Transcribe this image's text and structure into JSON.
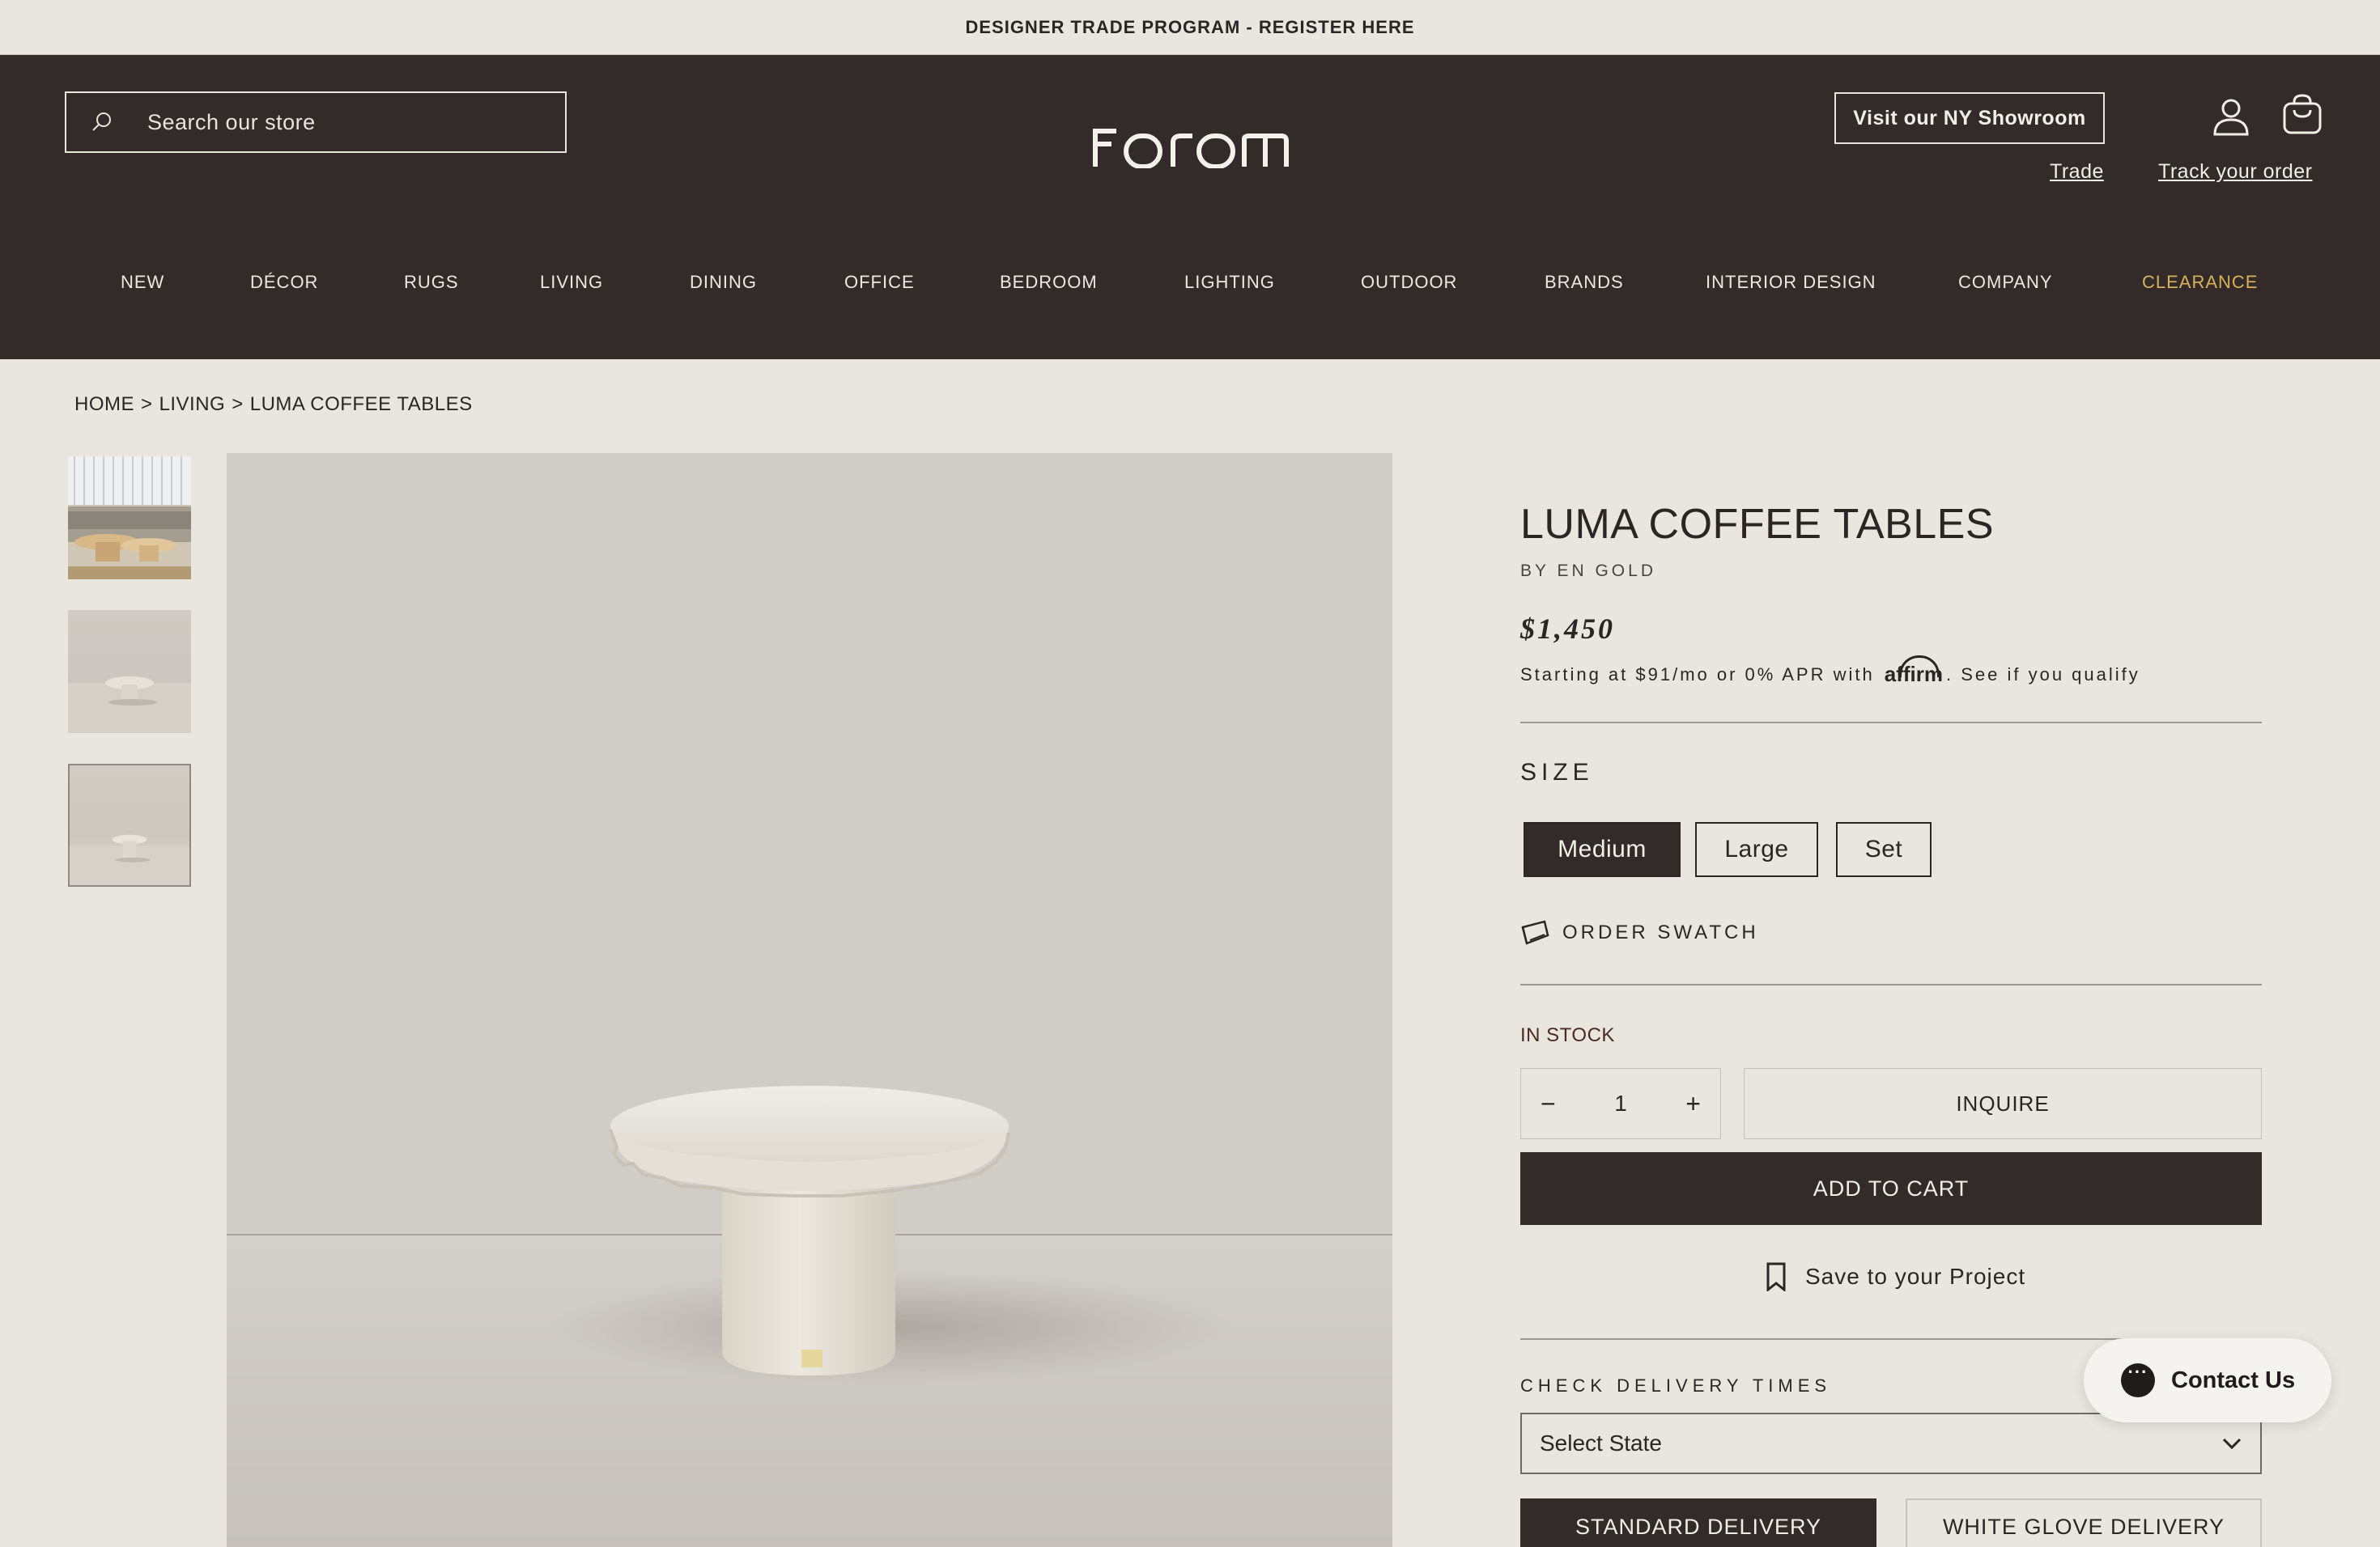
{
  "announcement": "DESIGNER TRADE PROGRAM - REGISTER HERE",
  "header": {
    "search_placeholder": "Search our store",
    "logo": "forom",
    "showroom_button": "Visit our NY Showroom",
    "links": {
      "trade": "Trade",
      "track": "Track your order"
    },
    "icons": {
      "search": "search-icon",
      "account": "account-icon",
      "cart": "cart-icon"
    }
  },
  "nav": {
    "items": [
      "NEW",
      "DÉCOR",
      "RUGS",
      "LIVING",
      "DINING",
      "OFFICE",
      "BEDROOM",
      "LIGHTING",
      "OUTDOOR",
      "BRANDS",
      "INTERIOR DESIGN",
      "COMPANY",
      "CLEARANCE"
    ]
  },
  "breadcrumb": {
    "items": [
      "HOME",
      "LIVING",
      "LUMA COFFEE TABLES"
    ],
    "separator": ">"
  },
  "product": {
    "title": "LUMA COFFEE TABLES",
    "brand": "BY EN GOLD",
    "price": "$1,450",
    "financing": {
      "prefix": "Starting at $91/mo or 0% APR with",
      "provider": "affirm",
      "suffix": ". See if you qualify"
    },
    "size_label": "SIZE",
    "sizes": [
      "Medium",
      "Large",
      "Set"
    ],
    "selected_size": "Medium",
    "swatch": "ORDER SWATCH",
    "stock": "IN STOCK",
    "quantity": {
      "minus": "−",
      "value": "1",
      "plus": "+"
    },
    "inquire": "INQUIRE",
    "add_to_cart": "ADD TO CART",
    "save_project": "Save to your Project",
    "delivery": {
      "label": "CHECK DELIVERY TIMES",
      "select_value": "Select State",
      "options": [
        "STANDARD DELIVERY",
        "WHITE GLOVE DELIVERY"
      ]
    }
  },
  "contact": {
    "label": "Contact Us"
  },
  "colors": {
    "header_bg": "#322b29",
    "page_bg": "#e8e6de",
    "accent_clearance": "#d8b25a"
  }
}
